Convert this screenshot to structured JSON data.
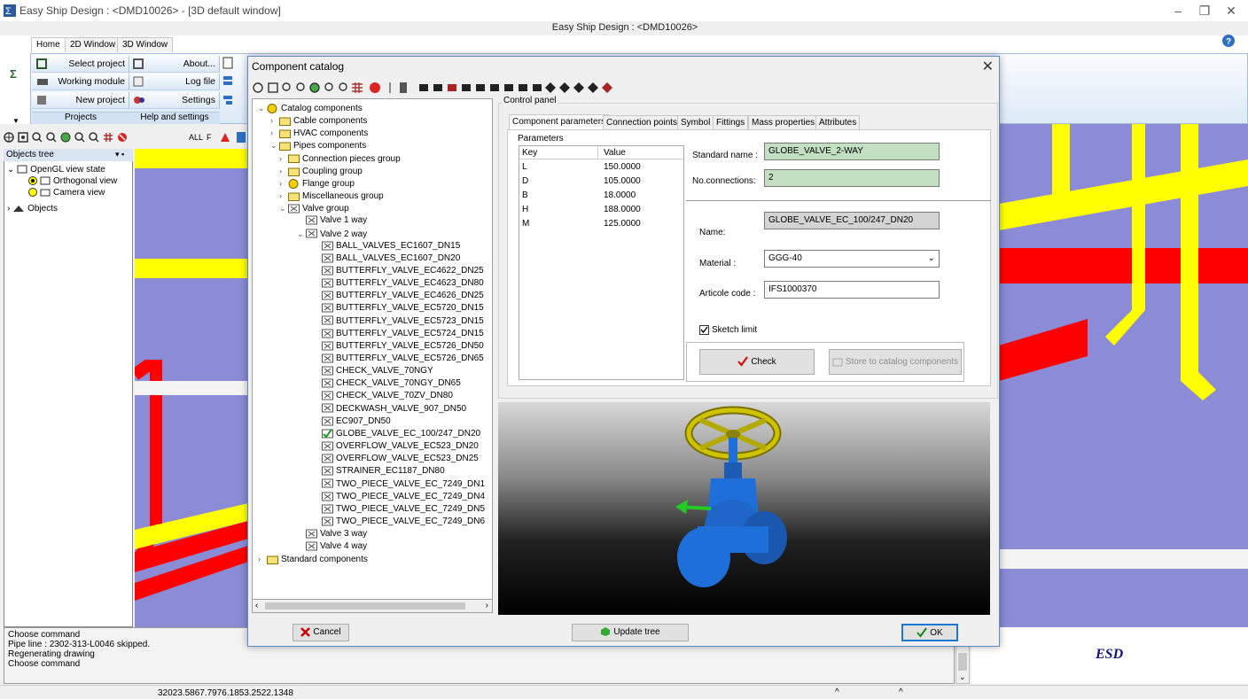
{
  "app": {
    "title": "Easy Ship Design : <DMD10026> - [3D default window]",
    "center_title": "Easy Ship Design : <DMD10026>"
  },
  "ribbon": {
    "tabs": [
      "Home",
      "2D Window",
      "3D Window"
    ],
    "buttons": {
      "select_project": "Select project",
      "working_module": "Working module",
      "new_project": "New project",
      "about": "About...",
      "log_file": "Log file",
      "settings": "Settings"
    },
    "groups": {
      "projects": "Projects",
      "help_settings": "Help and settings"
    }
  },
  "toolbar3d": {
    "all_label": "ALL",
    "f_label": "F"
  },
  "objects_tree": {
    "header": "Objects tree",
    "items": {
      "opengl": "OpenGL view state",
      "orthogonal": "Orthogonal view",
      "camera": "Camera view",
      "objects": "Objects"
    }
  },
  "command": {
    "lines": [
      "Choose command",
      "Pipe line : 2302-313-L0046 skipped.",
      "Regenerating drawing",
      "Choose command"
    ]
  },
  "status": {
    "coords": "32023.5867.7976.1853.2522.1348",
    "caret": "^"
  },
  "logo": "ESD",
  "dialog": {
    "title": "Component catalog",
    "tree": {
      "root": "Catalog components",
      "cable": "Cable components",
      "hvac": "HVAC components",
      "pipes": "Pipes components",
      "connection": "Connection pieces group",
      "coupling": "Coupling group",
      "flange": "Flange group",
      "misc": "Miscellaneous group",
      "valve": "Valve group",
      "valve1": "Valve 1 way",
      "valve2": "Valve 2 way",
      "valve2_items": [
        "BALL_VALVES_EC1607_DN15",
        "BALL_VALVES_EC1607_DN20",
        "BUTTERFLY_VALVE_EC4622_DN25",
        "BUTTERFLY_VALVE_EC4623_DN80",
        "BUTTERFLY_VALVE_EC4626_DN25",
        "BUTTERFLY_VALVE_EC5720_DN15",
        "BUTTERFLY_VALVE_EC5723_DN15",
        "BUTTERFLY_VALVE_EC5724_DN15",
        "BUTTERFLY_VALVE_EC5726_DN50",
        "BUTTERFLY_VALVE_EC5726_DN65",
        "CHECK_VALVE_70NGY",
        "CHECK_VALVE_70NGY_DN65",
        "CHECK_VALVE_70ZV_DN80",
        "DECKWASH_VALVE_907_DN50",
        "EC907_DN50",
        "GLOBE_VALVE_EC_100/247_DN20",
        "OVERFLOW_VALVE_EC523_DN20",
        "OVERFLOW_VALVE_EC523_DN25",
        "STRAINER_EC1187_DN80",
        "TWO_PIECE_VALVE_EC_7249_DN1",
        "TWO_PIECE_VALVE_EC_7249_DN4",
        "TWO_PIECE_VALVE_EC_7249_DN5",
        "TWO_PIECE_VALVE_EC_7249_DN6"
      ],
      "selected_index": 15,
      "valve3": "Valve 3 way",
      "valve4": "Valve 4 way",
      "standard": "Standard components"
    },
    "control_panel_label": "Control panel",
    "tabs": [
      "Component parameters",
      "Connection points",
      "Symbol",
      "Fittings",
      "Mass properties",
      "Attributes"
    ],
    "params_label": "Parameters",
    "param_headers": {
      "key": "Key",
      "value": "Value"
    },
    "params": [
      {
        "key": "L",
        "value": "150.0000"
      },
      {
        "key": "D",
        "value": "105.0000"
      },
      {
        "key": "B",
        "value": "18.0000"
      },
      {
        "key": "H",
        "value": "188.0000"
      },
      {
        "key": "M",
        "value": "125.0000"
      }
    ],
    "standard_name_label": "Standard name :",
    "standard_name": "GLOBE_VALVE_2-WAY",
    "no_connections_label": "No.connections:",
    "no_connections": "2",
    "name_label": "Name:",
    "name": "GLOBE_VALVE_EC_100/247_DN20",
    "material_label": "Material :",
    "material": "GGG-40",
    "article_label": "Articole code :",
    "article": "IFS1000370",
    "sketch_limit": "Sketch limit",
    "check_label": "Check",
    "store_label": "Store to catalog components",
    "cancel_label": "Cancel",
    "update_label": "Update tree",
    "ok_label": "OK"
  },
  "colors": {
    "pipe_red": "#ff0000",
    "pipe_yellow": "#ffff00",
    "valve_blue": "#1e6fd9",
    "accent": "#1c76d4"
  }
}
